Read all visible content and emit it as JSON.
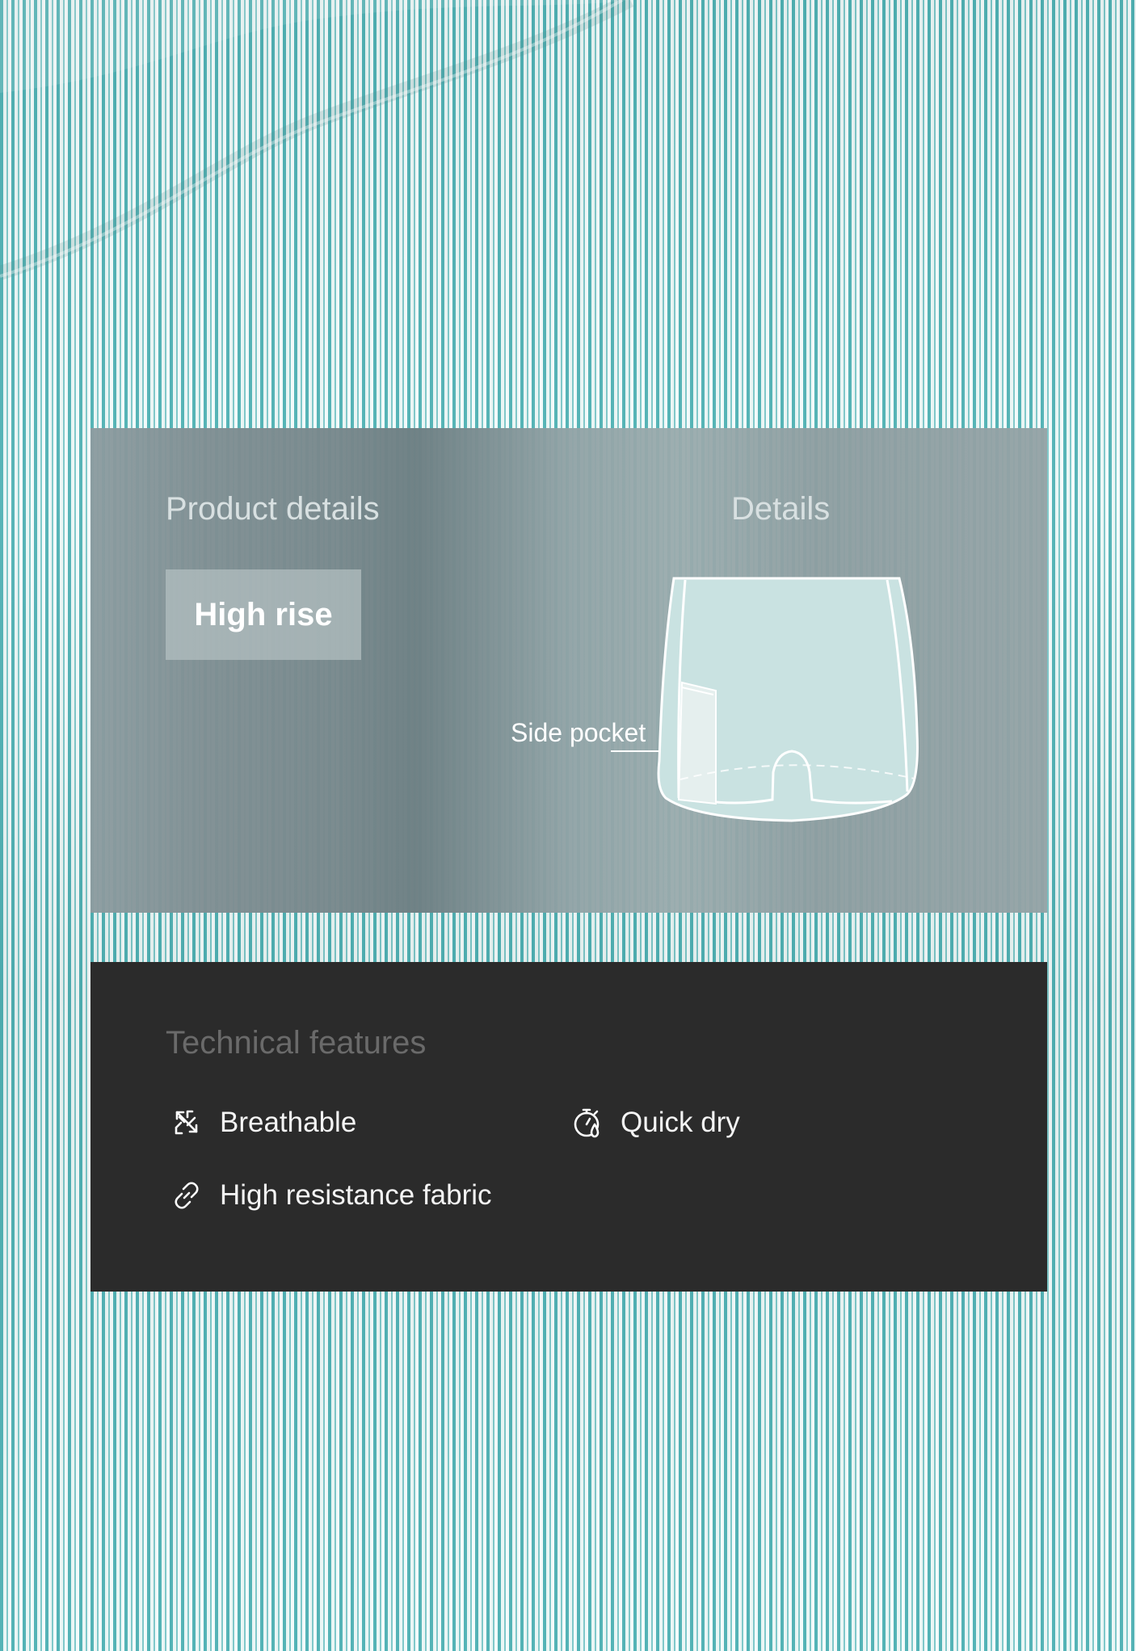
{
  "product_details": {
    "title": "Product details",
    "badge": "High rise",
    "details_title": "Details",
    "pocket_label": "Side pocket"
  },
  "technical_features": {
    "title": "Technical features",
    "items": [
      {
        "label": "Breathable",
        "icon": "breathable-icon"
      },
      {
        "label": "Quick dry",
        "icon": "stopwatch-icon"
      },
      {
        "label": "High resistance fabric",
        "icon": "link-icon"
      }
    ]
  }
}
